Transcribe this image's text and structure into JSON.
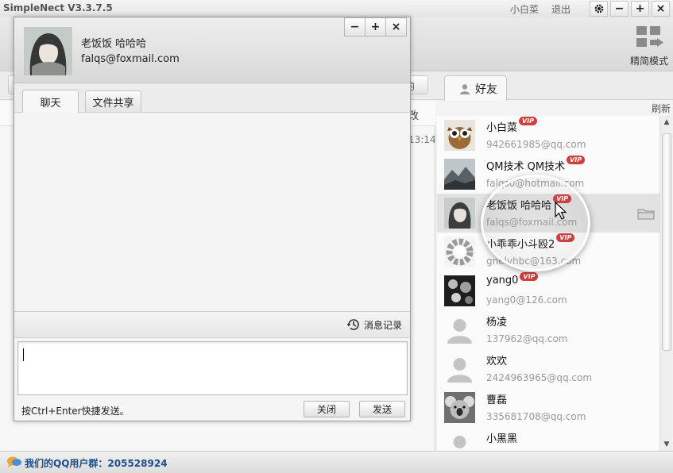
{
  "app": {
    "title": "SimpleNect V3.3.7.5",
    "user_name": "小白菜",
    "logout_label": "退出"
  },
  "toolbar": {
    "simple_mode_label": "精简模式",
    "hidden_button_label": "的"
  },
  "left_panel": {
    "column_header_text": "改",
    "row_time": "13:14"
  },
  "friends_panel": {
    "tab_label": "好友",
    "refresh_label": "刷新",
    "vip_label": "VIP",
    "items": [
      {
        "name": "小白菜",
        "email": "942661985@qq.com",
        "vip": true,
        "avatar": "owl"
      },
      {
        "name": "QM技术 QM技术",
        "email": "falqs0@hotmail.com",
        "vip": true,
        "avatar": "landscape"
      },
      {
        "name": "老饭饭 哈哈哈",
        "email": "falqs@foxmail.com",
        "vip": true,
        "avatar": "anime-girl",
        "selected": true
      },
      {
        "name": "小乖乖小斗殴2",
        "email": "gnelvhbc@163.com",
        "vip": true,
        "avatar": "spinner"
      },
      {
        "name": "yang0",
        "email": "yang0@126.com",
        "vip": true,
        "avatar": "photo-dark"
      },
      {
        "name": "杨凌",
        "email": "137962@qq.com",
        "vip": false,
        "avatar": "default-user"
      },
      {
        "name": "欢欢",
        "email": "2424963965@qq.com",
        "vip": false,
        "avatar": "default-user"
      },
      {
        "name": "曹磊",
        "email": "335681708@qq.com",
        "vip": false,
        "avatar": "koala"
      },
      {
        "name": "小黑黑",
        "email": "",
        "vip": false,
        "avatar": "default-user"
      }
    ]
  },
  "status_bar": {
    "group_text": "我们的QQ用户群：205528924"
  },
  "chat_window": {
    "contact_name": "老饭饭 哈哈哈",
    "contact_email": "falqs@foxmail.com",
    "tabs": [
      "聊天",
      "文件共享"
    ],
    "history_label": "消息记录",
    "input_value": "",
    "send_hint": "按Ctrl+Enter快捷发送。",
    "close_label": "关闭",
    "send_label": "发送"
  },
  "colors": {
    "vip_badge": "#d43c3c",
    "status_text": "#1b4f8a",
    "selected_row": "#e2e2e2"
  }
}
